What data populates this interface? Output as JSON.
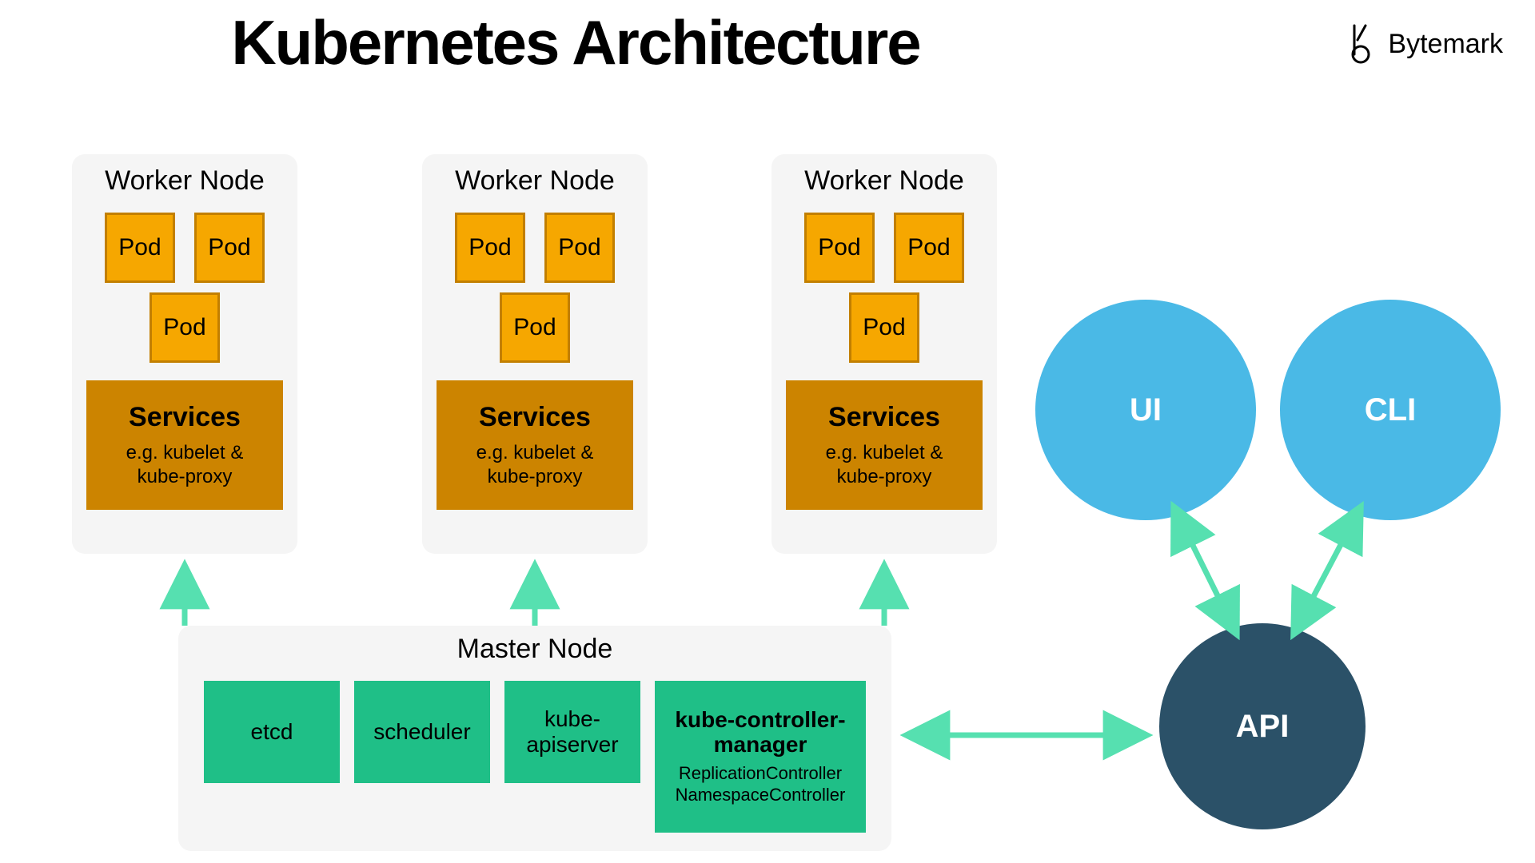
{
  "title": "Kubernetes Architecture",
  "brand": "Bytemark",
  "worker": {
    "title": "Worker Node",
    "pod": "Pod",
    "services_title": "Services",
    "services_desc1": "e.g. kubelet &",
    "services_desc2": "kube-proxy"
  },
  "master": {
    "title": "Master Node",
    "etcd": "etcd",
    "scheduler": "scheduler",
    "apiserver1": "kube-",
    "apiserver2": "apiserver",
    "kcm_title": "kube-controller-manager",
    "kcm_sub1": "ReplicationController",
    "kcm_sub2": "NamespaceController"
  },
  "circles": {
    "ui": "UI",
    "cli": "CLI",
    "api": "API"
  },
  "colors": {
    "arrow": "#56e0b0",
    "pod_fill": "#f6a700",
    "pod_border": "#c27f00",
    "services": "#cc8400",
    "master_box": "#1fbf87",
    "circle_light": "#4ab9e6",
    "circle_dark": "#2b5168",
    "panel": "#f5f5f5"
  }
}
